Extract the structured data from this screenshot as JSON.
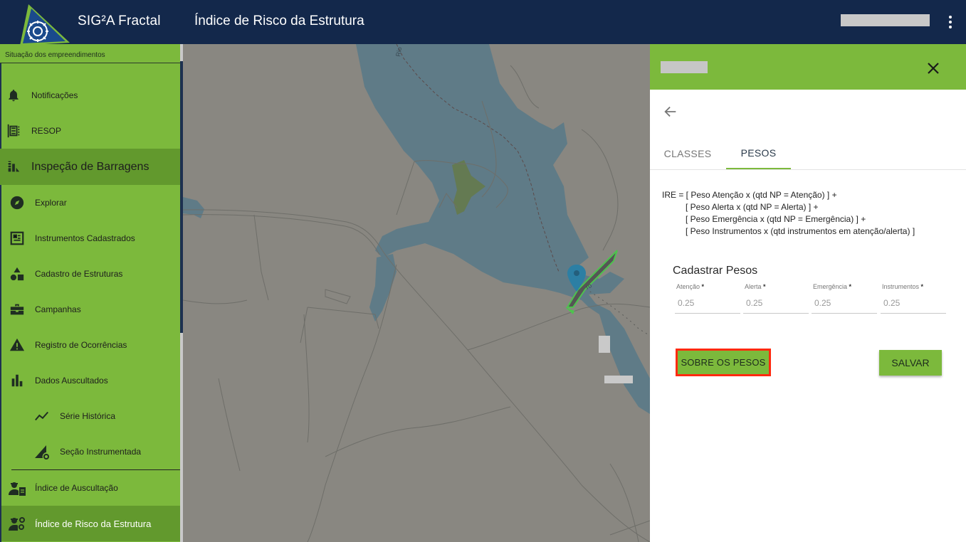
{
  "header": {
    "app_title": "SIG²A Fractal",
    "page_title": "Índice de Risco da Estrutura"
  },
  "sidebar": {
    "situation_label": "Situação dos empreendimentos",
    "items": [
      {
        "label": "Notificações",
        "icon": "bell-icon"
      },
      {
        "label": "RESOP",
        "icon": "resop-icon"
      },
      {
        "label": "Inspeção de Barragens",
        "icon": "dam-icon"
      },
      {
        "label": "Explorar",
        "icon": "compass-icon"
      },
      {
        "label": "Instrumentos Cadastrados",
        "icon": "instrument-icon"
      },
      {
        "label": "Cadastro de Estruturas",
        "icon": "shapes-icon"
      },
      {
        "label": "Campanhas",
        "icon": "briefcase-icon"
      },
      {
        "label": "Registro de Ocorrências",
        "icon": "warning-icon"
      },
      {
        "label": "Dados Auscultados",
        "icon": "bar-chart-icon"
      },
      {
        "label": "Série Histórica",
        "icon": "trend-line-icon"
      },
      {
        "label": "Seção Instrumentada",
        "icon": "section-gear-icon"
      },
      {
        "label": "Índice de Auscultação",
        "icon": "engineer-doc-icon"
      },
      {
        "label": "Índice de Risco da Estrutura",
        "icon": "engineer-gear-icon"
      }
    ]
  },
  "map": {
    "river_labels": [
      "Rio",
      "ro"
    ]
  },
  "panel": {
    "tabs": [
      {
        "label": "CLASSES",
        "active": false
      },
      {
        "label": "PESOS",
        "active": true
      }
    ],
    "formula_lines": [
      "IRE = [ Peso Atenção x (qtd NP = Atenção) ] +",
      "[ Peso Alerta x (qtd NP = Alerta) ] +",
      "[ Peso Emergência x (qtd NP = Emergência) ] +",
      "[ Peso Instrumentos x (qtd instrumentos em atenção/alerta) ]"
    ],
    "form_title": "Cadastrar Pesos",
    "fields": [
      {
        "label": "Atenção",
        "required_mark": "*",
        "value": "0.25"
      },
      {
        "label": "Alerta",
        "required_mark": "*",
        "value": "0.25"
      },
      {
        "label": "Emergência",
        "required_mark": "*",
        "value": "0.25"
      },
      {
        "label": "Instrumentos",
        "required_mark": "*",
        "value": "0.25"
      }
    ],
    "sobre_button": "SOBRE OS PESOS",
    "save_button": "SALVAR"
  },
  "colors": {
    "topbar": "#13284b",
    "green": "#7cb93c",
    "green_dark": "#62992d",
    "map_land": "#898781",
    "map_water": "#5f7b87",
    "highlight": "#ff2a10"
  }
}
